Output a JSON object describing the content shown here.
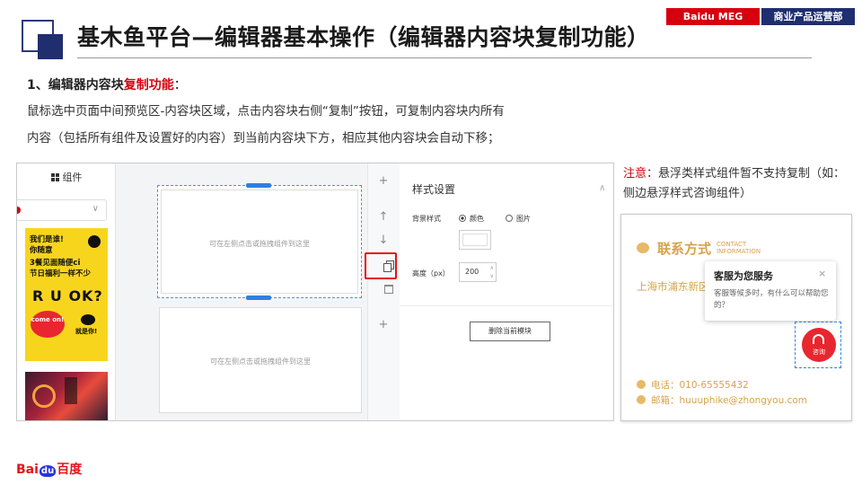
{
  "header": {
    "title": "基木鱼平台—编辑器基本操作（编辑器内容块复制功能）",
    "tag_left": "Baidu MEG",
    "tag_right": "商业产品运营部"
  },
  "section": {
    "heading_prefix": "1、编辑器内容块",
    "heading_highlight": "复制功能",
    "heading_suffix": "：",
    "desc_line1": "鼠标选中页面中间预览区-内容块区域，点击内容块右侧“复制”按钮，可复制内容块内所有",
    "desc_line2": "内容（包括所有组件及设置好的内容）到当前内容块下方，相应其他内容块会自动下移；"
  },
  "editor": {
    "components_label": "组件",
    "poster_lines": [
      "我们是谁!",
      "你随意",
      "3餐见面随便ci",
      "节日福利一样不少"
    ],
    "poster_big": "R U OK?",
    "poster_bubble": "come on!",
    "poster_small": "就是你!",
    "block_hint": "可在左侧点击或拖拽组件到这里",
    "tools": {
      "add_top": "+",
      "up": "↑",
      "down": "↓",
      "add_bottom": "+"
    },
    "style_panel": {
      "title": "样式设置",
      "bg_label": "背景样式",
      "opt_color": "颜色",
      "opt_image": "图片",
      "height_label": "高度（px）",
      "height_value": "200",
      "delete_button": "删除当前模块"
    }
  },
  "note": {
    "highlight": "注意",
    "text": "：悬浮类样式组件暂不支持复制（如：侧边悬浮样式咨询组件）"
  },
  "contact_card": {
    "title": "联系方式",
    "title_en_1": "CONTACT",
    "title_en_2": "INFORMATION",
    "address": "上海市浦东新区",
    "popup_title": "客服为您服务",
    "popup_close": "×",
    "popup_body": "客服等候多时，有什么可以帮助您的？",
    "consult_label": "咨询",
    "phone": "电话：010-65555432",
    "email": "邮箱：huuuphike@zhongyou.com"
  },
  "footer": {
    "logo_a": "Bai",
    "logo_b": "du",
    "logo_c": "百度"
  },
  "colors": {
    "accent_red": "#d7000f",
    "navy": "#1f2e6e",
    "gold": "#d8a24a",
    "selection_blue": "#2f7fe0"
  }
}
